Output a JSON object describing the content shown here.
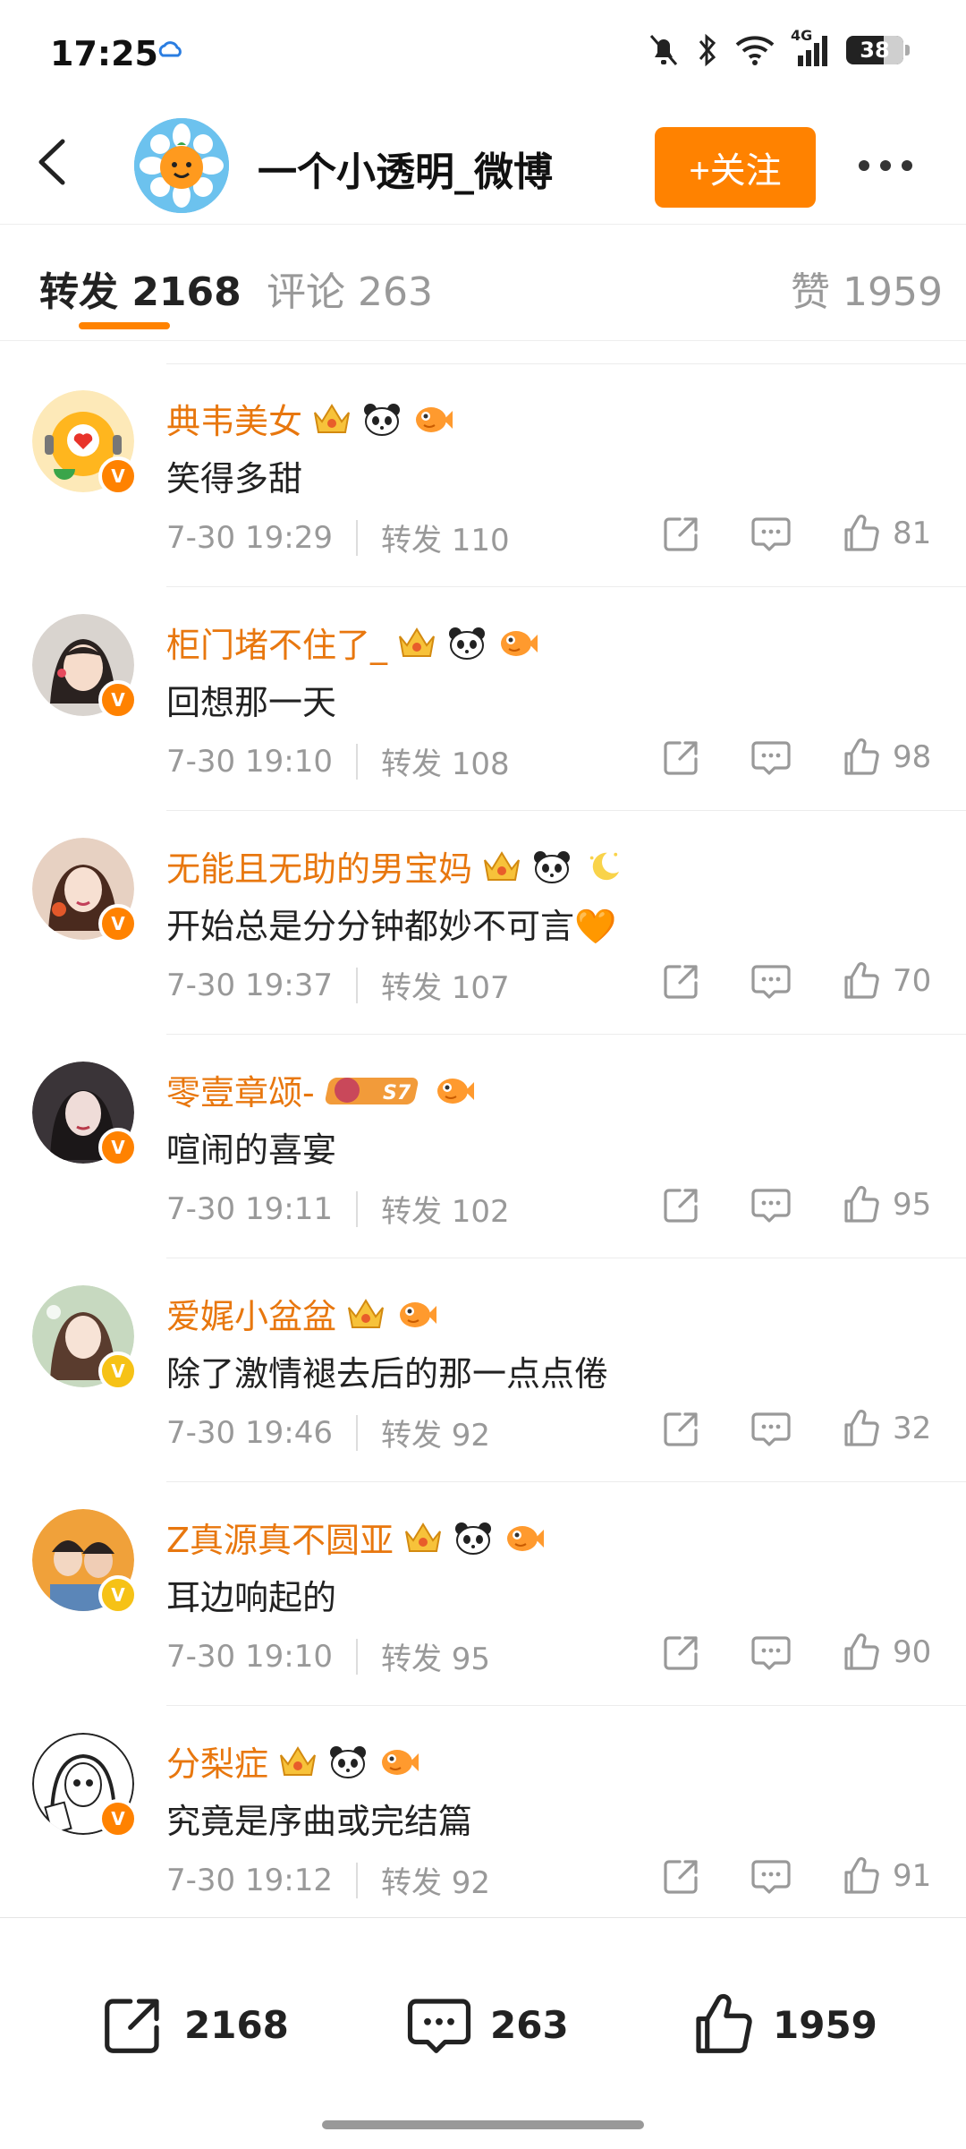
{
  "status": {
    "time": "17:25",
    "network": "4G",
    "battery": "38"
  },
  "header": {
    "title": "一个小透明_微博",
    "follow_label": "+关注"
  },
  "tabs": {
    "repost": "转发 2168",
    "comment": "评论 263",
    "like": "赞 1959"
  },
  "items": [
    {
      "name": "典韦美女",
      "text": "笑得多甜",
      "time": "7-30 19:29",
      "repost": "转发 110",
      "likes": "81",
      "badges": [
        "crown-badge",
        "panda-badge",
        "fish-badge"
      ],
      "vcolor": "orange"
    },
    {
      "name": "柜门堵不住了_",
      "text": "回想那一天",
      "time": "7-30 19:10",
      "repost": "转发 108",
      "likes": "98",
      "badges": [
        "crown-badge",
        "panda-badge",
        "fish-badge"
      ],
      "vcolor": "orange"
    },
    {
      "name": "无能且无助的男宝妈",
      "text": "开始总是分分钟都妙不可言🧡",
      "time": "7-30 19:37",
      "repost": "转发 107",
      "likes": "70",
      "badges": [
        "crown-badge",
        "panda-badge",
        "moon-badge"
      ],
      "vcolor": "orange"
    },
    {
      "name": "零壹章颂-",
      "text": "喧闹的喜宴",
      "time": "7-30 19:11",
      "repost": "转发 102",
      "likes": "95",
      "badges": [
        "s7-badge",
        "fish-badge"
      ],
      "s7": "S7",
      "vcolor": "orange"
    },
    {
      "name": "爱娓小盆盆",
      "text": "除了激情褪去后的那一点点倦",
      "time": "7-30 19:46",
      "repost": "转发 92",
      "likes": "32",
      "badges": [
        "crown-badge",
        "fish-badge"
      ],
      "vcolor": "yellow"
    },
    {
      "name": "Z真源真不圆亚",
      "text": "耳边响起的",
      "time": "7-30 19:10",
      "repost": "转发 95",
      "likes": "90",
      "badges": [
        "crown-badge",
        "panda-badge",
        "fish-badge"
      ],
      "vcolor": "yellow"
    },
    {
      "name": "分梨症",
      "text": "究竟是序曲或完结篇",
      "time": "7-30 19:12",
      "repost": "转发 92",
      "likes": "91",
      "badges": [
        "crown-badge",
        "panda-badge",
        "fish-badge"
      ],
      "vcolor": "orange"
    }
  ],
  "bottom": {
    "repost": "2168",
    "comment": "263",
    "like": "1959"
  },
  "colors": {
    "accent": "#ff8200",
    "name": "#e8770e",
    "muted": "#999999"
  }
}
